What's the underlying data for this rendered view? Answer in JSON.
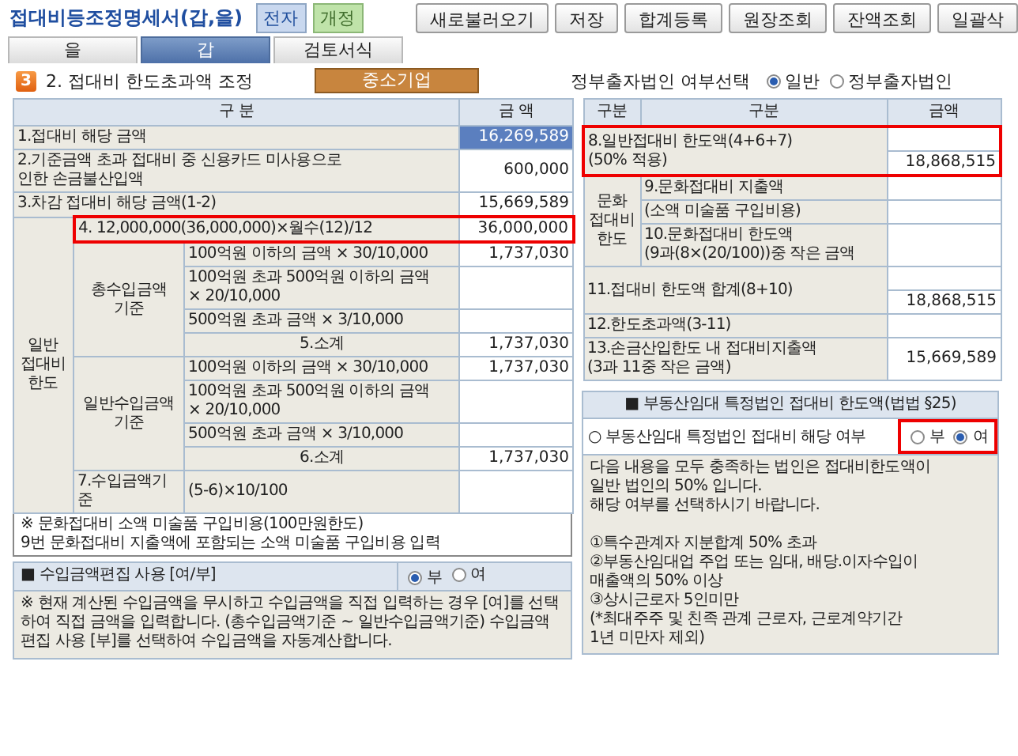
{
  "header": {
    "title": "접대비등조정명세서(갑,을)",
    "badges": [
      {
        "label": "전자",
        "kind": "electronic"
      },
      {
        "label": "개정",
        "kind": "revised"
      }
    ],
    "buttons": [
      "새로불러오기",
      "저장",
      "합계등록",
      "원장조회",
      "잔액조회",
      "일괄삭"
    ]
  },
  "tabs": [
    {
      "label": "을",
      "selected": false
    },
    {
      "label": "갑",
      "selected": true
    },
    {
      "label": "검토서식",
      "selected": false
    }
  ],
  "section": {
    "number": "3",
    "title": "2. 접대비 한도초과액 조정",
    "company_type": "중소기업",
    "choice_label": "정부출자법인 여부선택",
    "options": [
      {
        "label": "일반",
        "selected": true
      },
      {
        "label": "정부출자법인",
        "selected": false
      }
    ]
  },
  "left_table": {
    "columns": [
      "구 분",
      "금 액"
    ],
    "rows": [
      {
        "label": "1.접대비 해당 금액",
        "amount": "16,269,589",
        "selected": true
      },
      {
        "label": "2.기준금액 초과 접대비 중 신용카드 미사용으로\n인한 손금불산입액",
        "amount": "600,000",
        "selected": false
      },
      {
        "label": "3.차감 접대비 해당 금액(1-2)",
        "amount": "15,669,589",
        "selected": false
      }
    ],
    "limit_group": {
      "label": "일반\n접대비\n한도",
      "base": {
        "label": "4. 12,000,000(36,000,000)×월수(12)/12",
        "amount": "36,000,000",
        "highlighted": true
      },
      "groups": [
        {
          "label": "총수입금액\n기준",
          "items": [
            {
              "label": "100억원 이하의 금액 × 30/10,000",
              "amount": "1,737,030"
            },
            {
              "label": "100억원 초과 500억원 이하의 금액\n× 20/10,000"
            },
            {
              "label": "500억원 초과 금액 × 3/10,000"
            }
          ],
          "subtotal": {
            "label": "5.소계",
            "amount": "1,737,030"
          }
        },
        {
          "label": "일반수입금액\n기준",
          "items": [
            {
              "label": "100억원 이하의 금액 × 30/10,000",
              "amount": "1,737,030"
            },
            {
              "label": "100억원 초과 500억원 이하의 금액\n× 20/10,000"
            },
            {
              "label": "500억원 초과 금액 × 3/10,000"
            }
          ],
          "subtotal": {
            "label": "6.소계",
            "amount": "1,737,030"
          }
        }
      ],
      "income_basis": {
        "label": "7.수입금액기준",
        "formula": "(5-6)×10/100"
      }
    }
  },
  "note": "※ 문화접대비 소액 미술품 구입비용(100만원한도)\n  9번 문화접대비 지출액에 포함되는 소액 미술품 구입비용 입력",
  "income_edit": {
    "title": "■ 수입금액편집 사용 [여/부]",
    "options": [
      {
        "label": "부",
        "selected": true
      },
      {
        "label": "여",
        "selected": false
      }
    ],
    "note": "※ 현재 계산된 수입금액을 무시하고 수입금액을 직접 입력하는 경우 [여]를 선택하여 직접 금액을 입력합니다. (총수입금액기준 ~ 일반수입금액기준) 수입금액편집 사용 [부]를 선택하여 수입금액을 자동계산합니다."
  },
  "right_table": {
    "columns": [
      "구분",
      "구분",
      "금액"
    ],
    "rows": [
      {
        "kind": "split",
        "label": "8.일반접대비 한도액(4+6+7)\n      (50% 적용)",
        "amount": "18,868,515",
        "highlighted": true
      },
      {
        "kind": "group",
        "label": "문화\n접대비\n한도",
        "items": [
          {
            "label": "9.문화접대비 지출액"
          },
          {
            "label": "(소액 미술품 구입비용)"
          },
          {
            "label": "10.문화접대비 한도액\n(9과(8×(20/100))중 작은 금액"
          }
        ]
      },
      {
        "kind": "split",
        "label": "11.접대비 한도액 합계(8+10)",
        "amount": "18,868,515",
        "highlighted": false
      },
      {
        "kind": "plain",
        "label": "12.한도초과액(3-11)"
      },
      {
        "kind": "plain",
        "label": "13.손금산입한도 내 접대비지출액\n(3과 11중 작은 금액)",
        "amount": "15,669,589"
      }
    ]
  },
  "realty": {
    "title": "■ 부동산임대 특정법인 접대비 한도액(법법 §25)",
    "question": "○ 부동산임대 특정법인 접대비 해당 여부",
    "highlighted": true,
    "options": [
      {
        "label": "부",
        "selected": false
      },
      {
        "label": "여",
        "selected": true
      }
    ],
    "text": "다음 내용을 모두 충족하는 법인은 접대비한도액이\n일반 법인의 50% 입니다.\n해당 여부를 선택하시기 바랍니다.\n\n①특수관계자 지분합계 50% 초과\n②부동산임대업 주업 또는 임대, 배당.이자수입이\n  매출액의 50% 이상\n③상시근로자 5인미만\n (*최대주주 및 친족 관계 근로자, 근로계약기간\n 1년 미만자 제외)"
  }
}
